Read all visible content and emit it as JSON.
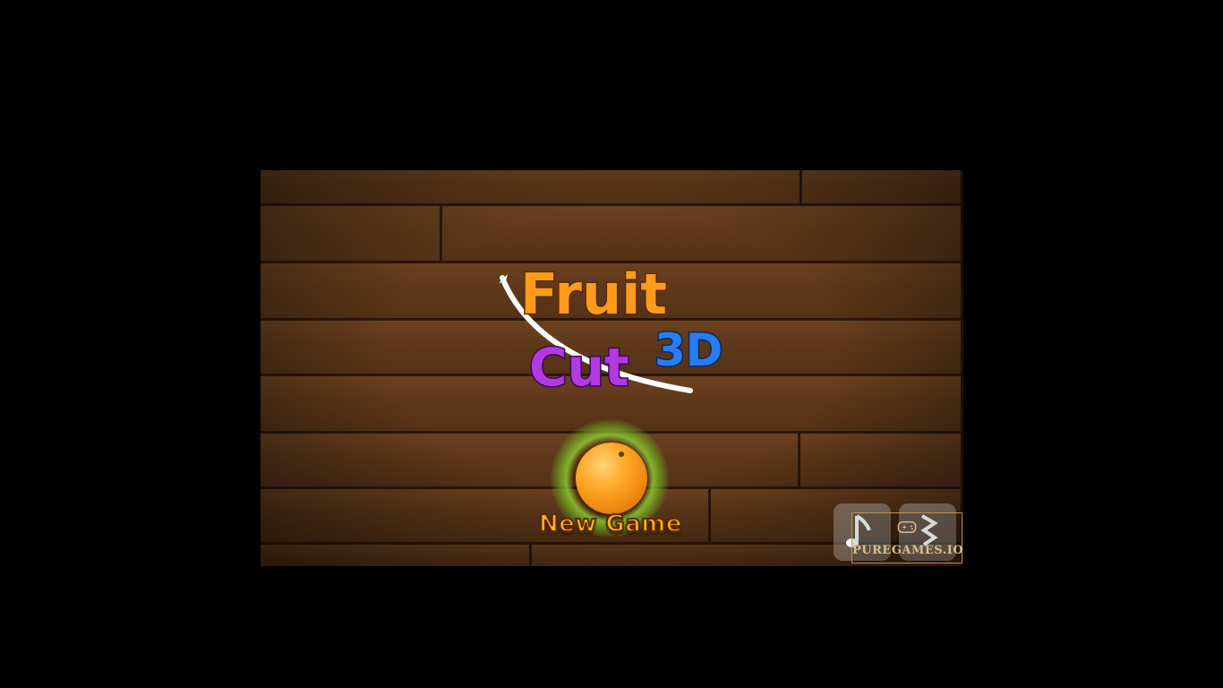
{
  "logo": {
    "word1": "Fruit",
    "word2": "Cut",
    "word3": "3D",
    "colors": {
      "orange": "#ff9a1a",
      "yellow": "#ffd21a",
      "green": "#6fd12a",
      "red": "#ff3a2a",
      "purple": "#b23ae0",
      "blue": "#2a7cf0"
    }
  },
  "menu": {
    "new_game_label": "New Game",
    "new_game_icon": "orange-fruit-icon"
  },
  "controls": {
    "music_icon": "music-note-icon",
    "sound_icon": "sound-wave-icon"
  },
  "watermark": {
    "text": "PUREGAMES.IO",
    "icon": "gamepad-icon"
  }
}
